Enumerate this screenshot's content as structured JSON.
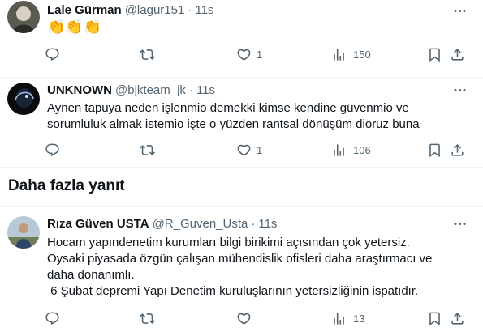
{
  "tweets": [
    {
      "name": "Lale Gürman",
      "handle": "@lagur151",
      "dot": "·",
      "time": "11s",
      "text": "👏👏👏",
      "likes": "1",
      "views": "150"
    },
    {
      "name": "UNKNOWN",
      "handle": "@bjkteam_jk",
      "dot": "·",
      "time": "11s",
      "text": "Aynen tapuya neden işlenmio demekki kimse kendine güvenmio ve sorumluluk almak istemio işte o yüzden rantsal dönüşüm dioruz buna",
      "likes": "1",
      "views": "106"
    },
    {
      "name": "Rıza Güven USTA",
      "handle": "@R_Guven_Usta",
      "dot": "·",
      "time": "11s",
      "text": "Hocam yapındenetim kurumları bilgi birikimi açısından çok yetersiz.\nOysaki piyasada özgün çalışan mühendislik ofisleri daha araştırmacı ve daha donanımlı.\n 6 Şubat depremi Yapı Denetim kuruluşlarının yetersizliğinin ispatıdır.",
      "likes": "",
      "views": "13"
    }
  ],
  "section_title": "Daha fazla yanıt",
  "icons": {
    "reply": "reply-icon",
    "retweet": "retweet-icon",
    "like": "heart-icon",
    "views": "views-icon",
    "bookmark": "bookmark-icon",
    "share": "share-icon",
    "more": "more-icon"
  },
  "colors": {
    "text_primary": "#0f1419",
    "text_secondary": "#536471",
    "divider": "#eff3f4"
  }
}
